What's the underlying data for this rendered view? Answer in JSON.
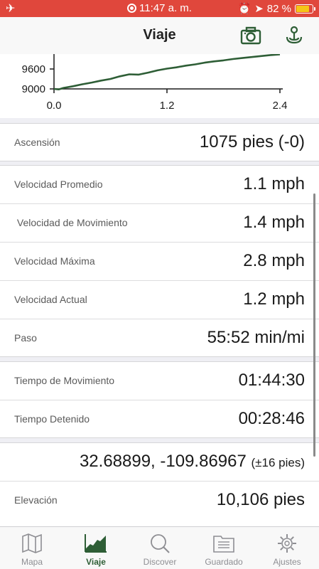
{
  "status_bar": {
    "time": "11:47 a. m.",
    "battery": "82 %",
    "battery_level": 0.82,
    "icons": [
      "airplane-icon",
      "record-icon",
      "alarm-icon",
      "location-arrow-icon",
      "battery-icon"
    ]
  },
  "nav": {
    "title": "Viaje",
    "left_action_icon": "camera-icon",
    "right_action_icon": "signal-icon"
  },
  "chart_data": {
    "type": "line",
    "y_ticks": [
      "9600",
      "9000"
    ],
    "x_ticks": [
      "0.0",
      "1.2",
      "2.4"
    ],
    "xlim": [
      0,
      2.4
    ],
    "ylim": [
      9000,
      10150
    ],
    "color": "#2e5e36",
    "series": [
      {
        "x": [
          0.0,
          0.05,
          0.1,
          0.2,
          0.3,
          0.4,
          0.5,
          0.6,
          0.7,
          0.8,
          0.9,
          1.0,
          1.1,
          1.2,
          1.3,
          1.4,
          1.5,
          1.6,
          1.7,
          1.8,
          1.9,
          2.0,
          2.1,
          2.2,
          2.3,
          2.4
        ],
        "y": [
          9000,
          8985,
          9030,
          9080,
          9140,
          9190,
          9250,
          9300,
          9380,
          9440,
          9430,
          9490,
          9560,
          9610,
          9650,
          9700,
          9740,
          9790,
          9830,
          9860,
          9900,
          9930,
          9960,
          9990,
          10020,
          10040
        ]
      }
    ]
  },
  "ascension": {
    "label": "Ascensión",
    "value": "1075 pies (-0)"
  },
  "speed_section": {
    "rows": [
      {
        "label": "Velocidad Promedio",
        "value": "1.1 mph"
      },
      {
        "label": " Velocidad de Movimiento",
        "value": "1.4 mph"
      },
      {
        "label": "Velocidad Máxima",
        "value": "2.8 mph"
      },
      {
        "label": "Velocidad Actual",
        "value": "1.2 mph"
      },
      {
        "label": "Paso",
        "value": "55:52 min/mi"
      }
    ]
  },
  "time_section": {
    "rows": [
      {
        "label": "Tiempo de Movimiento",
        "value": "01:44:30"
      },
      {
        "label": "Tiempo Detenido",
        "value": "00:28:46"
      }
    ]
  },
  "location_section": {
    "coordinates": "32.68899, -109.86967",
    "accuracy": "(±16 pies)",
    "elevation_label": "Elevación",
    "elevation_value": "10,106 pies"
  },
  "tabs": [
    {
      "label": "Mapa",
      "icon": "map-icon",
      "active": false
    },
    {
      "label": "Viaje",
      "icon": "trip-chart-icon",
      "active": true
    },
    {
      "label": "Discover",
      "icon": "search-icon",
      "active": false
    },
    {
      "label": "Guardado",
      "icon": "folder-icon",
      "active": false
    },
    {
      "label": "Ajustes",
      "icon": "gear-icon",
      "active": false
    }
  ]
}
